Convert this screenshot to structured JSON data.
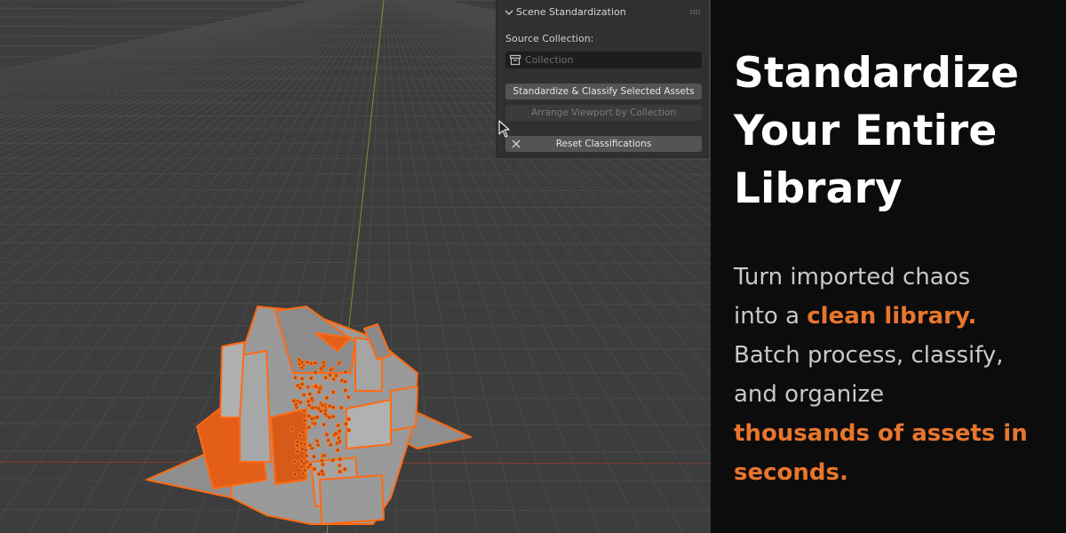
{
  "panel": {
    "title": "Scene Standardization",
    "source_label": "Source Collection:",
    "collection_placeholder": "Collection",
    "standardize_button": "Standardize & Classify Selected Assets",
    "arrange_button": "Arrange Viewport by Collection",
    "reset_button": "Reset Classifications"
  },
  "promo": {
    "headline_line1": "Standardize",
    "headline_line2": "Your Entire",
    "headline_line3": "Library",
    "body_1": "Turn imported chaos",
    "body_2": "into a ",
    "body_2_highlight": "clean library.",
    "body_3": "Batch process, classify,",
    "body_4": "and organize",
    "body_5_highlight": "thousands of assets in",
    "body_6_highlight": "seconds."
  },
  "colors": {
    "accent": "#e8762d",
    "viewport_bg": "#3d3d3d",
    "panel_bg": "#303030",
    "text_panel_bg": "#0c0c0c",
    "selection_orange": "#ff6a13"
  },
  "icons": [
    "chevron-down-icon",
    "drag-handle-icon",
    "collection-icon",
    "close-icon",
    "mouse-cursor-icon"
  ]
}
